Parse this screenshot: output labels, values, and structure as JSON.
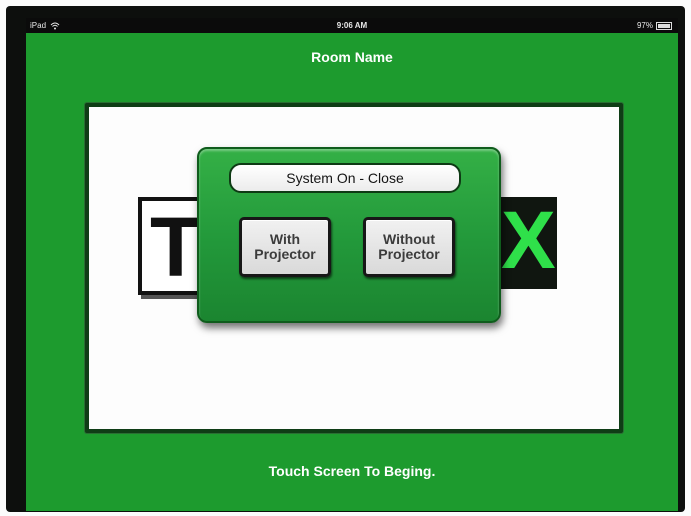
{
  "status_bar": {
    "device": "iPad",
    "time": "9:06 AM",
    "battery_percent": "97%",
    "battery_level": 0.97
  },
  "header": {
    "title": "Room Name"
  },
  "logo": {
    "left_letter": "T",
    "right_letter": "X"
  },
  "dialog": {
    "title": "System On - Close",
    "with_projector": [
      "With",
      "Projector"
    ],
    "without_projector": [
      "Without",
      "Projector"
    ]
  },
  "footer": {
    "text": "Touch Screen To Beging."
  },
  "colors": {
    "background": "#1d9b2e",
    "accent": "#2fe04a",
    "dialog": "#22983a"
  }
}
